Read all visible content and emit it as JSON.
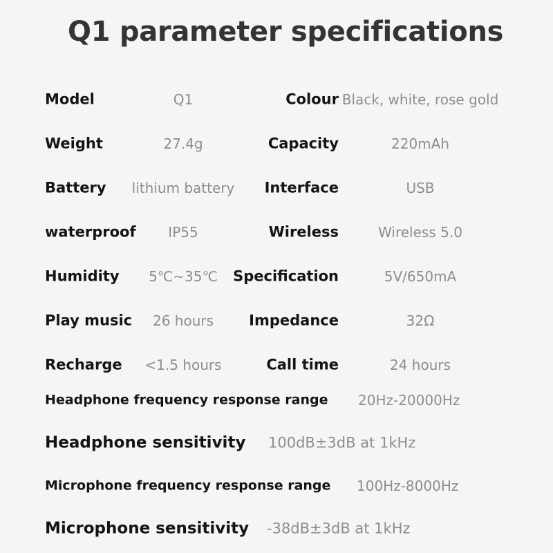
{
  "page": {
    "title": "Q1 parameter specifications",
    "background_color": "#f5f5f5",
    "label_color": "#141414",
    "value_color": "#8d8d8d",
    "title_color": "#343434"
  },
  "paired_rows": [
    {
      "left_label": "Model",
      "left_value": "Q1",
      "right_label": "Colour",
      "right_value": "Black, white, rose gold"
    },
    {
      "left_label": "Weight",
      "left_value": "27.4g",
      "right_label": "Capacity",
      "right_value": "220mAh"
    },
    {
      "left_label": "Battery",
      "left_value": "lithium battery",
      "right_label": "Interface",
      "right_value": "USB"
    },
    {
      "left_label": "waterproof",
      "left_value": "IP55",
      "right_label": "Wireless",
      "right_value": "Wireless 5.0"
    },
    {
      "left_label": "Humidity",
      "left_value": "5℃~35℃",
      "right_label": "Specification",
      "right_value": "5V/650mA"
    },
    {
      "left_label": "Play music",
      "left_value": "26 hours",
      "right_label": "Impedance",
      "right_value": "32Ω"
    },
    {
      "left_label": "Recharge",
      "left_value": "<1.5 hours",
      "right_label": "Call time",
      "right_value": "24 hours"
    }
  ],
  "full_rows": [
    {
      "label": "Headphone frequency response range",
      "value": "20Hz-20000Hz"
    },
    {
      "label": "Headphone sensitivity",
      "value": "100dB±3dB at 1kHz"
    },
    {
      "label": "Microphone frequency response range",
      "value": "100Hz-8000Hz"
    },
    {
      "label": "Microphone sensitivity",
      "value": "-38dB±3dB at 1kHz"
    }
  ]
}
